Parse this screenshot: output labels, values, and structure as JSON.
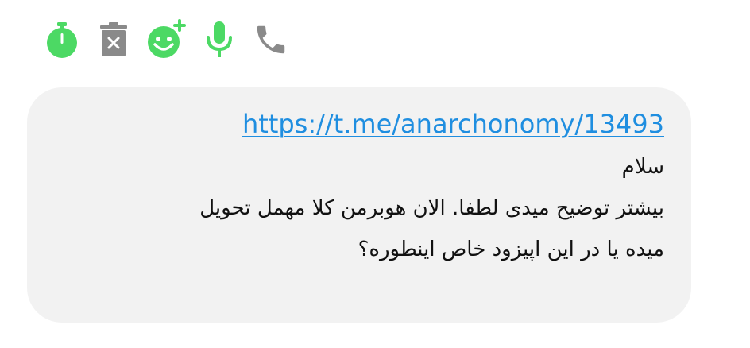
{
  "toolbar": {
    "icons": [
      {
        "name": "timer-icon",
        "color": "#4cd964"
      },
      {
        "name": "delete-icon",
        "color": "#8a8a8a"
      },
      {
        "name": "add-reaction-icon",
        "color": "#4cd964"
      },
      {
        "name": "mic-icon",
        "color": "#4cd964"
      },
      {
        "name": "phone-icon",
        "color": "#8a8a8a"
      }
    ]
  },
  "message": {
    "link": "https://t.me/anarchonomy/13493",
    "lines": [
      "سلام",
      "بیشتر توضیح میدی لطفا. الان هوبرمن کلا مهمل تحویل",
      "میده یا در این اپیزود خاص اینطوره؟"
    ],
    "bubble_color": "#f2f2f2",
    "link_color": "#1f8ee0",
    "text_color": "#111111"
  }
}
